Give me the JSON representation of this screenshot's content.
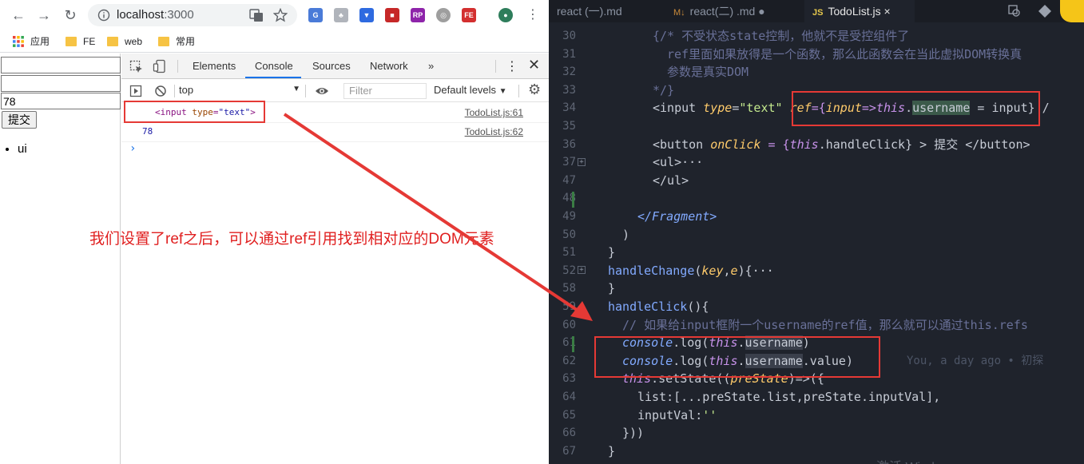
{
  "browser": {
    "url_host": "localhost",
    "url_port": ":3000",
    "bookmarks": [
      {
        "label": "应用",
        "icon": "apps-grid-icon"
      },
      {
        "label": "FE",
        "icon": "folder-icon"
      },
      {
        "label": "web",
        "icon": "folder-icon"
      },
      {
        "label": "常用",
        "icon": "folder-icon"
      }
    ],
    "extensions": [
      "RP",
      "FE"
    ]
  },
  "page": {
    "input_value": "78",
    "submit_label": "提交",
    "list_items": [
      "ui"
    ]
  },
  "devtools": {
    "tabs": [
      "Elements",
      "Console",
      "Sources",
      "Network"
    ],
    "more_tabs": "»",
    "context": "top",
    "filter_placeholder": "Filter",
    "levels": "Default levels",
    "lines": [
      {
        "tag_open": "<input ",
        "attr": "type",
        "eq": "=",
        "value": "\"text\"",
        "tag_close": ">",
        "source": "TodoList.js:61"
      },
      {
        "value": "78",
        "source": "TodoList.js:62"
      }
    ],
    "prompt": "›"
  },
  "annotation": "我们设置了ref之后，可以通过ref引用找到相对应的DOM元素",
  "editor": {
    "tabs": [
      {
        "label": "react (一).md",
        "type": "md"
      },
      {
        "label": "react(二) .md",
        "type": "md",
        "modified": "●"
      },
      {
        "label": "TodoList.js",
        "type": "js",
        "close": "×"
      }
    ],
    "js_badge": "JS",
    "md_badge": "M↓",
    "line_numbers": [
      "30",
      "31",
      "32",
      "33",
      "34",
      "35",
      "36",
      "37",
      "47",
      "48",
      "49",
      "50",
      "51",
      "52",
      "58",
      "59",
      "60",
      "61",
      "62",
      "63",
      "64",
      "65",
      "66",
      "67"
    ],
    "comment_30": "{/* 不受状态state控制，他就不是受控组件了",
    "comment_31": "ref里面如果放得是一个函数，那么此函数会在当此虚拟DOM转换真",
    "comment_32": "参数是真实DOM",
    "comment_33": "*/}",
    "line_34_a": "<input ",
    "line_34_attr": "type",
    "line_34_eq": "=",
    "line_34_str": "\"text\"",
    "line_34_ref": "ref",
    "line_34_b": "={",
    "line_34_param": "input",
    "line_34_arrow": "=>",
    "line_34_this": "this",
    "line_34_dot": ".",
    "line_34_prop": "username",
    "line_34_c": " = input} /",
    "line_36_a": "<button ",
    "line_36_attr": "onClick",
    "line_36_b": " = {",
    "line_36_this": "this",
    "line_36_c": ".handleClick} > 提交 </button>",
    "line_37": "<ul>···",
    "line_47": "</ul>",
    "line_49": "</Fragment>",
    "line_50": ")",
    "line_51": "}",
    "line_52_fn": "handleChange",
    "line_52_a": "(",
    "line_52_p1": "key",
    "line_52_b": ",",
    "line_52_p2": "e",
    "line_52_c": "){···",
    "line_58": "}",
    "line_59_fn": "handleClick",
    "line_59_a": "(){",
    "line_60": "// 如果给input框附一个username的ref值，那么就可以通过this.refs",
    "line_61_obj": "console",
    "line_61_a": ".log(",
    "line_61_this": "this",
    "line_61_prop": "username",
    "line_61_b": ")",
    "line_62_obj": "console",
    "line_62_a": ".log(",
    "line_62_this": "this",
    "line_62_prop": "username",
    "line_62_b": ".value)",
    "blame": "You, a day ago • 初探",
    "line_63_this": "this",
    "line_63_a": ".setState((",
    "line_63_p": "preState",
    "line_63_b": ")=>({",
    "line_64": "list:[...preState.list,preState.inputVal],",
    "line_65_a": "inputVal:",
    "line_65_str": "''",
    "line_66": "}))",
    "line_67": "}",
    "watermark": "激活 Wind"
  }
}
